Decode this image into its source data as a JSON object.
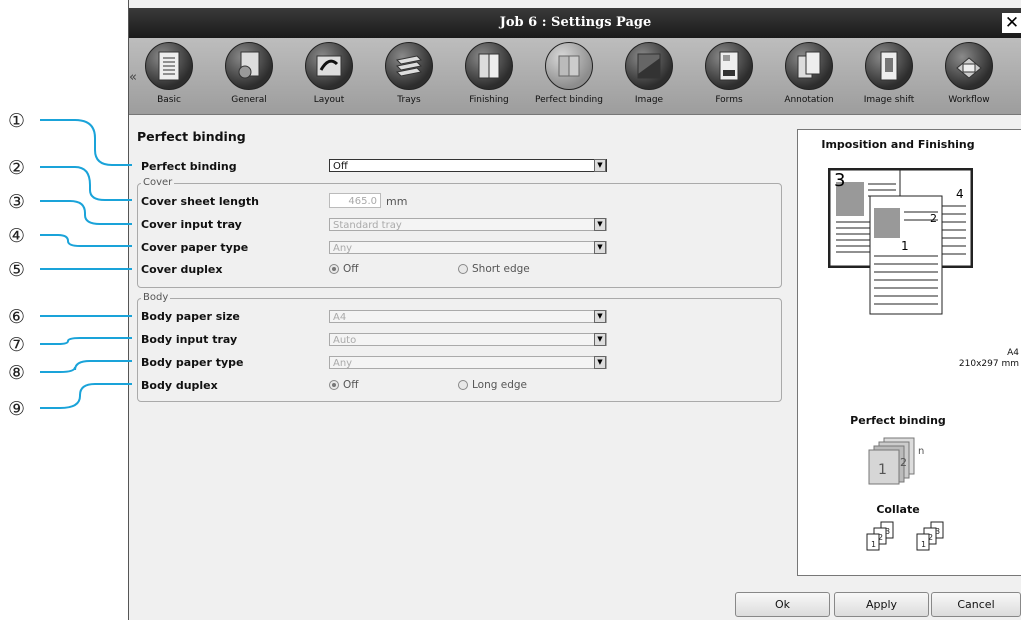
{
  "window": {
    "title": "Job 6 : Settings Page",
    "close_glyph": "✕"
  },
  "toolbar": {
    "scroll_left": "«",
    "items": [
      {
        "label": "Basic",
        "icon": "basic-icon"
      },
      {
        "label": "General",
        "icon": "general-icon"
      },
      {
        "label": "Layout",
        "icon": "layout-icon"
      },
      {
        "label": "Trays",
        "icon": "trays-icon"
      },
      {
        "label": "Finishing",
        "icon": "finishing-icon"
      },
      {
        "label": "Perfect binding",
        "icon": "perfect-binding-icon",
        "selected": true
      },
      {
        "label": "Image",
        "icon": "image-icon"
      },
      {
        "label": "Forms",
        "icon": "forms-icon"
      },
      {
        "label": "Annotation",
        "icon": "annotation-icon"
      },
      {
        "label": "Image shift",
        "icon": "image-shift-icon"
      },
      {
        "label": "Workflow",
        "icon": "workflow-icon"
      }
    ]
  },
  "panel": {
    "title": "Perfect binding",
    "perfect_binding": {
      "label": "Perfect binding",
      "value": "Off"
    },
    "cover": {
      "legend": "Cover",
      "sheet_length": {
        "label": "Cover sheet length",
        "value": "465.0",
        "unit": "mm"
      },
      "input_tray": {
        "label": "Cover input tray",
        "value": "Standard tray"
      },
      "paper_type": {
        "label": "Cover paper type",
        "value": "Any"
      },
      "duplex": {
        "label": "Cover duplex",
        "option1": "Off",
        "option2": "Short edge"
      }
    },
    "body": {
      "legend": "Body",
      "paper_size": {
        "label": "Body paper size",
        "value": "A4"
      },
      "input_tray": {
        "label": "Body input tray",
        "value": "Auto"
      },
      "paper_type": {
        "label": "Body paper type",
        "value": "Any"
      },
      "duplex": {
        "label": "Body duplex",
        "option1": "Off",
        "option2": "Long edge"
      }
    }
  },
  "preview": {
    "title": "Imposition and Finishing",
    "page_numbers": [
      "3",
      "4",
      "2",
      "1"
    ],
    "paper_name": "A4",
    "paper_dims": "210x297 mm",
    "binding_title": "Perfect binding",
    "binding_numbers": [
      "1",
      "2",
      "n"
    ],
    "collate_title": "Collate",
    "collate_numbers": [
      "1",
      "2",
      "3"
    ]
  },
  "buttons": {
    "ok": "Ok",
    "apply": "Apply",
    "cancel": "Cancel"
  },
  "callouts": [
    "①",
    "②",
    "③",
    "④",
    "⑤",
    "⑥",
    "⑦",
    "⑧",
    "⑨"
  ],
  "colors": {
    "callout_line": "#1aa3d9",
    "titlebar": "#2a2a2a",
    "toolbar": "#acacac"
  }
}
